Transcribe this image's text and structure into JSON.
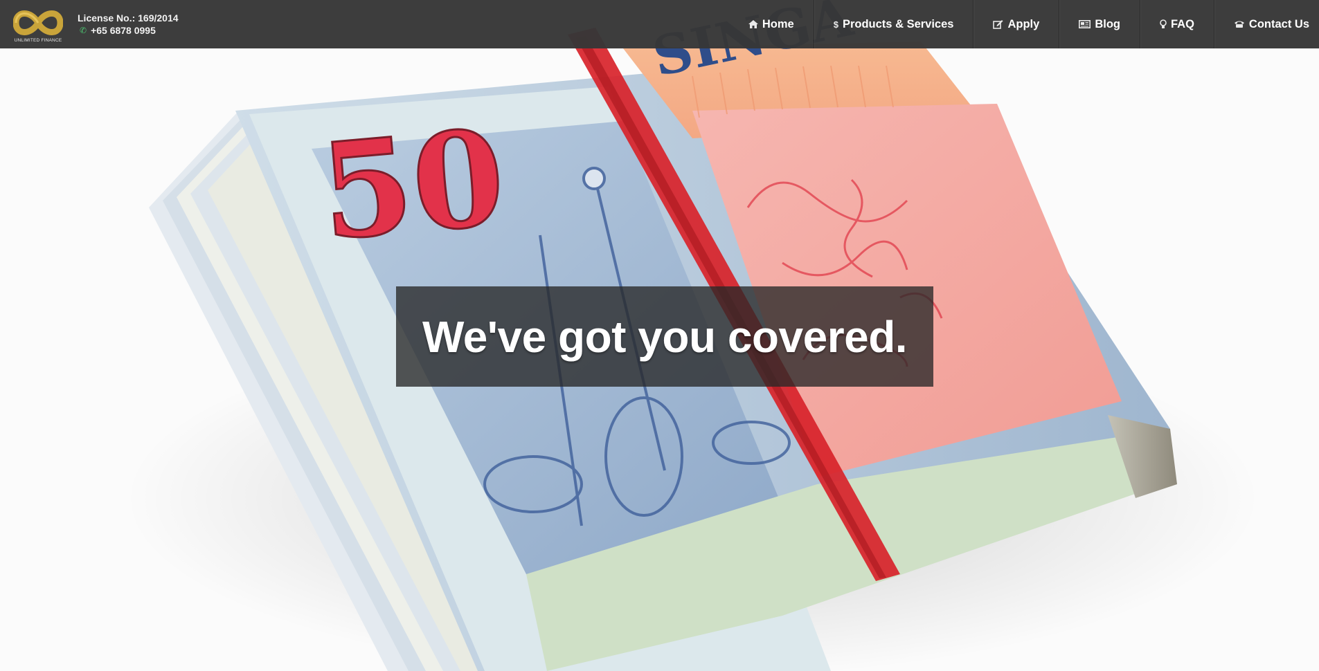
{
  "brand": {
    "logo_caption": "UNLIMITED FINANCE",
    "license": "License No.: 169/2014",
    "phone": "+65 6878 0995",
    "logo_color": "#c9a43a"
  },
  "nav": {
    "items": [
      {
        "label": "Home",
        "icon": "home-icon"
      },
      {
        "label": "Products & Services",
        "icon": "dollar-icon"
      },
      {
        "label": "Apply",
        "icon": "edit-icon"
      },
      {
        "label": "Blog",
        "icon": "newspaper-icon"
      },
      {
        "label": "FAQ",
        "icon": "lightbulb-icon"
      },
      {
        "label": "Contact Us",
        "icon": "phone-icon"
      }
    ]
  },
  "hero": {
    "tagline": "We've got you covered.",
    "banknote_numeral": "50",
    "banknote_text": "SINGA"
  },
  "colors": {
    "header_bg": "#373737",
    "phone_accent": "#4cc270",
    "rubber_band": "#d8232a"
  }
}
